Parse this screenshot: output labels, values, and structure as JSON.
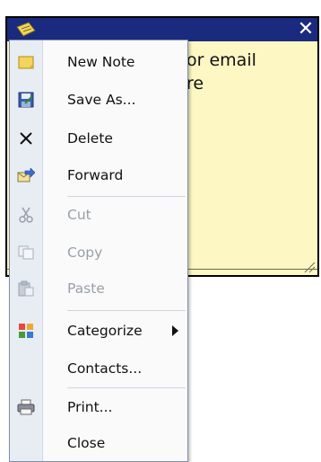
{
  "note": {
    "close_glyph": "✕",
    "body_lines": [
      "or email",
      "re"
    ],
    "background_color": "#fdf7c3",
    "titlebar_color": "#1a2a7e"
  },
  "menu": {
    "items": [
      {
        "label": "New Note",
        "icon": "new-note-icon",
        "enabled": true
      },
      {
        "label": "Save As...",
        "icon": "save-as-icon",
        "enabled": true
      },
      {
        "label": "Delete",
        "icon": "delete-icon",
        "enabled": true
      },
      {
        "label": "Forward",
        "icon": "forward-icon",
        "enabled": true
      },
      {
        "label": "Cut",
        "icon": "scissors-icon",
        "enabled": false
      },
      {
        "label": "Copy",
        "icon": "copy-icon",
        "enabled": false
      },
      {
        "label": "Paste",
        "icon": "paste-icon",
        "enabled": false
      },
      {
        "label": "Categorize",
        "icon": "categorize-icon",
        "enabled": true,
        "submenu": true
      },
      {
        "label": "Contacts...",
        "icon": "",
        "enabled": true
      },
      {
        "label": "Print...",
        "icon": "printer-icon",
        "enabled": true
      },
      {
        "label": "Close",
        "icon": "",
        "enabled": true
      }
    ]
  }
}
